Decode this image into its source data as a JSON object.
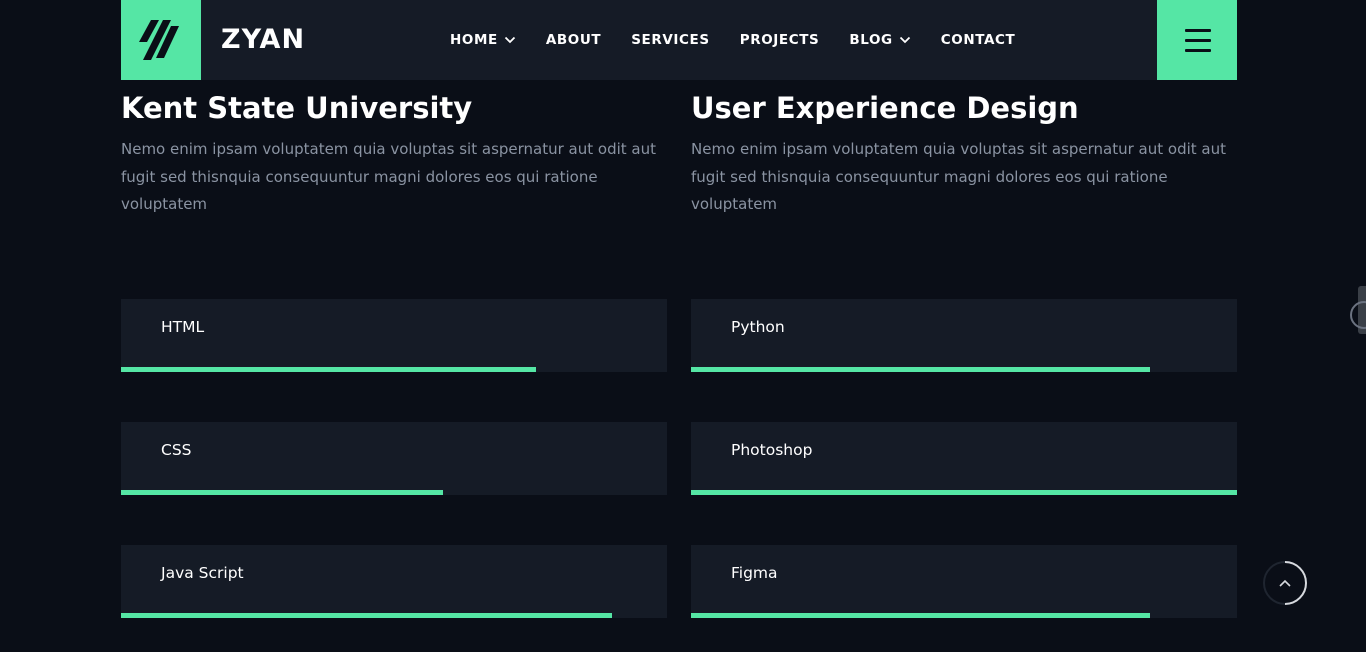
{
  "header": {
    "brand": "ZYAN",
    "nav": [
      {
        "label": "HOME",
        "has_dropdown": true
      },
      {
        "label": "ABOUT",
        "has_dropdown": false
      },
      {
        "label": "SERVICES",
        "has_dropdown": false
      },
      {
        "label": "PROJECTS",
        "has_dropdown": false
      },
      {
        "label": "BLOG",
        "has_dropdown": true
      },
      {
        "label": "CONTACT",
        "has_dropdown": false
      }
    ],
    "menu_icon": "hamburger-icon",
    "logo_icon": "zyan-slashes-logo"
  },
  "education": [
    {
      "title": "Kent State University",
      "text": "Nemo enim ipsam voluptatem quia voluptas sit aspernatur aut odit aut fugit sed thisnquia consequuntur magni dolores eos qui ratione voluptatem"
    },
    {
      "title": "User Experience Design",
      "text": "Nemo enim ipsam voluptatem quia voluptas sit aspernatur aut odit aut fugit sed thisnquia consequuntur magni dolores eos qui ratione voluptatem"
    }
  ],
  "skills_left": [
    {
      "label": "HTML",
      "level": 0.76
    },
    {
      "label": "CSS",
      "level": 0.59
    },
    {
      "label": "Java Script",
      "level": 0.9
    }
  ],
  "skills_right": [
    {
      "label": "Python",
      "level": 0.84
    },
    {
      "label": "Photoshop",
      "level": 1.0
    },
    {
      "label": "Figma",
      "level": 0.84
    }
  ],
  "back_to_top_icon": "chevron-up-icon",
  "colors": {
    "background": "#0a0e17",
    "card": "#151b26",
    "accent": "#55e6a5",
    "muted_text": "#8a93a2"
  }
}
